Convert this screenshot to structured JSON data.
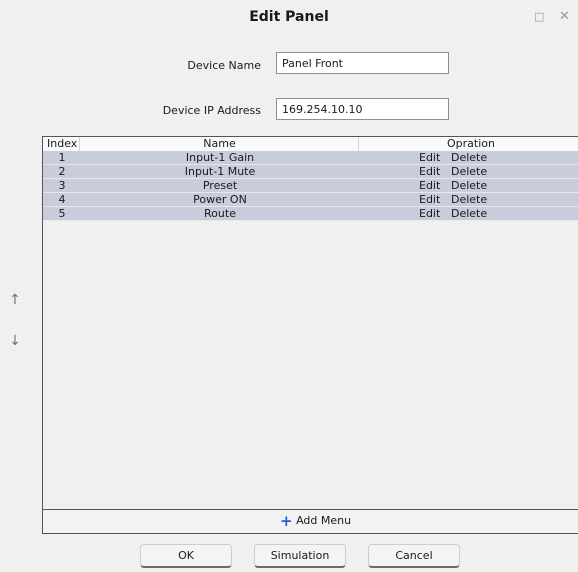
{
  "window": {
    "title": "Edit Panel",
    "maximize_glyph": "□",
    "close_glyph": "✕"
  },
  "form": {
    "device_name_label": "Device Name",
    "device_name_value": "Panel Front",
    "device_ip_label": "Device IP Address",
    "device_ip_value": "169.254.10.10"
  },
  "table": {
    "headers": {
      "index": "Index",
      "name": "Name",
      "operation": "Opration"
    },
    "rows": [
      {
        "index": "1",
        "name": "Input-1 Gain",
        "edit": "Edit",
        "delete": "Delete"
      },
      {
        "index": "2",
        "name": "Input-1 Mute",
        "edit": "Edit",
        "delete": "Delete"
      },
      {
        "index": "3",
        "name": "Preset",
        "edit": "Edit",
        "delete": "Delete"
      },
      {
        "index": "4",
        "name": "Power ON",
        "edit": "Edit",
        "delete": "Delete"
      },
      {
        "index": "5",
        "name": "Route",
        "edit": "Edit",
        "delete": "Delete"
      }
    ],
    "row_color": "#c8ccdb"
  },
  "side": {
    "up_glyph": "↑",
    "down_glyph": "↓"
  },
  "add_menu": {
    "plus_glyph": "+",
    "label": "Add Menu",
    "accent": "#1e5fd6"
  },
  "buttons": {
    "ok": "OK",
    "simulation": "Simulation",
    "cancel": "Cancel"
  }
}
